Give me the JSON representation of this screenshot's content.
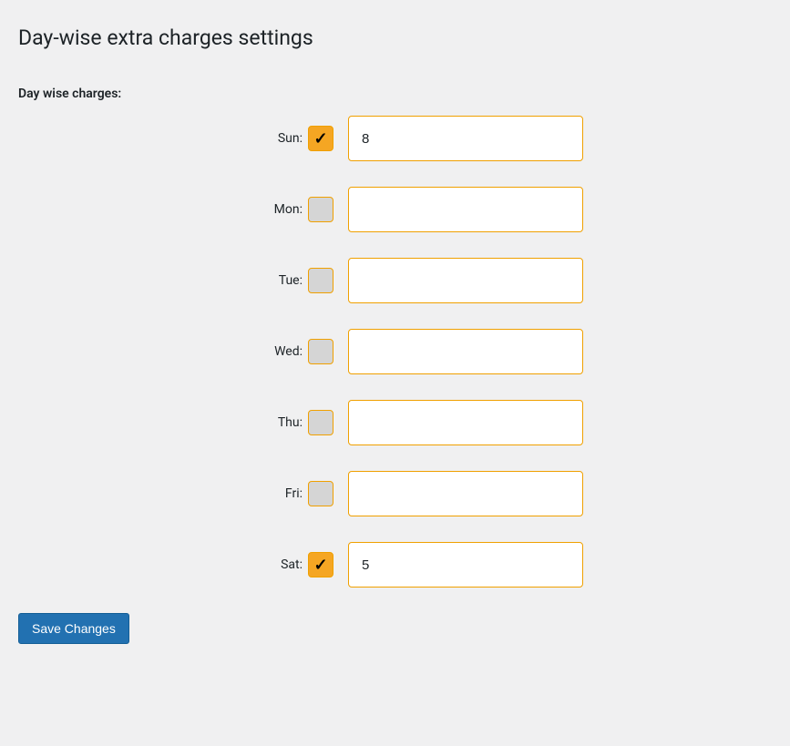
{
  "page_title": "Day-wise extra charges settings",
  "section_label": "Day wise charges:",
  "days": [
    {
      "key": "sun",
      "label": "Sun:",
      "checked": true,
      "value": "8"
    },
    {
      "key": "mon",
      "label": "Mon:",
      "checked": false,
      "value": ""
    },
    {
      "key": "tue",
      "label": "Tue:",
      "checked": false,
      "value": ""
    },
    {
      "key": "wed",
      "label": "Wed:",
      "checked": false,
      "value": ""
    },
    {
      "key": "thu",
      "label": "Thu:",
      "checked": false,
      "value": ""
    },
    {
      "key": "fri",
      "label": "Fri:",
      "checked": false,
      "value": ""
    },
    {
      "key": "sat",
      "label": "Sat:",
      "checked": true,
      "value": "5"
    }
  ],
  "checkmark_glyph": "✓",
  "save_button_label": "Save Changes"
}
